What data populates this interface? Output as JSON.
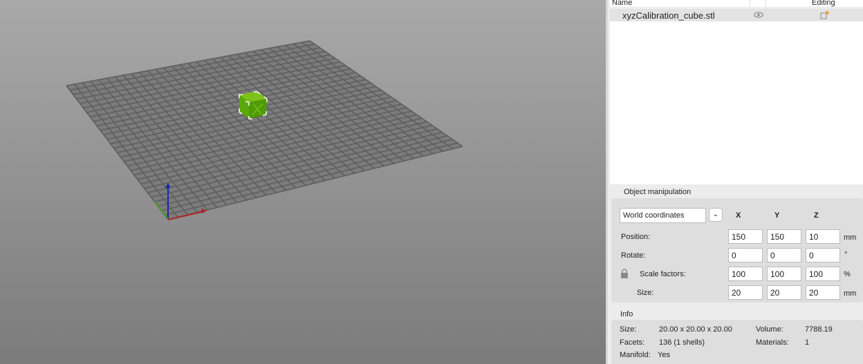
{
  "object_list": {
    "col_name": "Name",
    "col_editing": "Editing",
    "items": [
      {
        "name": "xyzCalibration_cube.stl",
        "visible": true
      }
    ]
  },
  "manipulation": {
    "title": "Object manipulation",
    "coord_system": "World coordinates",
    "axes": [
      "X",
      "Y",
      "Z"
    ],
    "rows": [
      {
        "label": "Position:",
        "values": [
          "150",
          "150",
          "10"
        ],
        "unit": "mm"
      },
      {
        "label": "Rotate:",
        "values": [
          "0",
          "0",
          "0"
        ],
        "unit": "°"
      },
      {
        "label": "Scale factors:",
        "values": [
          "100",
          "100",
          "100"
        ],
        "unit": "%"
      },
      {
        "label": "Size:",
        "values": [
          "20",
          "20",
          "20"
        ],
        "unit": "mm"
      }
    ]
  },
  "info": {
    "title": "Info",
    "size_label": "Size:",
    "size": "20.00 x 20.00 x 20.00",
    "volume_label": "Volume:",
    "volume": "7788.19",
    "facets_label": "Facets:",
    "facets": "136 (1 shells)",
    "materials_label": "Materials:",
    "materials": "1",
    "manifold_label": "Manifold:",
    "manifold": "Yes"
  },
  "colors": {
    "model": "#5aa80a",
    "bed": "#6e6e6e",
    "accent": "#f0a030"
  }
}
